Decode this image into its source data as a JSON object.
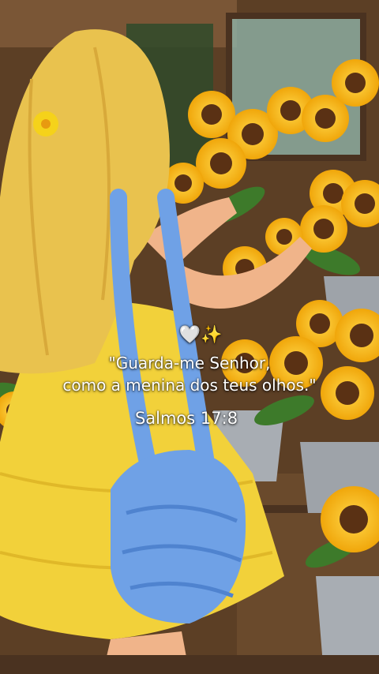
{
  "colors": {
    "wall": "#6b4a2c",
    "dress": "#f2d13a",
    "hair": "#e9c24e",
    "bag": "#6fa1e6",
    "sunflower_petal": "#f5b90f",
    "sunflower_center": "#5a3114",
    "bucket": "#a8adb3"
  },
  "overlay": {
    "emoji_heart": "🤍",
    "emoji_sparkles": "✨",
    "quote_line1": "\"Guarda-me Senhor,",
    "quote_line2": "como a menina dos teus olhos.\"",
    "reference": "Salmos 17:8"
  }
}
